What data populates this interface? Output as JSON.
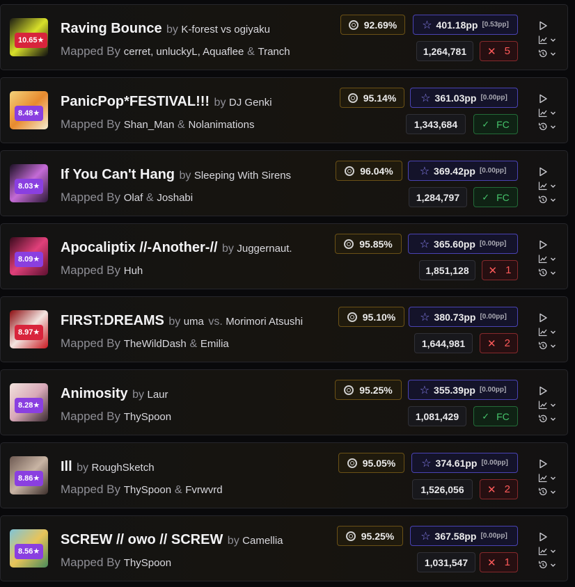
{
  "scores": [
    {
      "title": "Raving Bounce",
      "by": "by",
      "artist_parts": [
        "K-forest vs ogiyaku"
      ],
      "mapped_by": "Mapped By",
      "mappers": [
        "cerret, unluckyL, Aquaflee",
        "Tranch"
      ],
      "difficulty": "10.65★",
      "difficulty_color": "#d8243c",
      "accuracy": "92.69%",
      "pp": "401.18pp",
      "pp_gain": "[0.53pp]",
      "score": "1,264,781",
      "result": {
        "type": "miss",
        "value": "5"
      },
      "cover_colors": [
        "#1b1b12",
        "#d8e02a",
        "#0e0e0e"
      ]
    },
    {
      "title": "PanicPop*FESTIVAL!!!",
      "by": "by",
      "artist_parts": [
        "DJ Genki"
      ],
      "mapped_by": "Mapped By",
      "mappers": [
        "Shan_Man",
        "Nolanimations"
      ],
      "difficulty": "8.48★",
      "difficulty_color": "#8a3fe0",
      "accuracy": "95.14%",
      "pp": "361.03pp",
      "pp_gain": "[0.00pp]",
      "score": "1,343,684",
      "result": {
        "type": "fc",
        "value": "FC"
      },
      "cover_colors": [
        "#f3d27a",
        "#e88a2e",
        "#f6ecd0"
      ]
    },
    {
      "title": "If You Can't Hang",
      "by": "by",
      "artist_parts": [
        "Sleeping With Sirens"
      ],
      "mapped_by": "Mapped By",
      "mappers": [
        "Olaf",
        "Joshabi"
      ],
      "difficulty": "8.03★",
      "difficulty_color": "#8a3fe0",
      "accuracy": "96.04%",
      "pp": "369.42pp",
      "pp_gain": "[0.00pp]",
      "score": "1,284,797",
      "result": {
        "type": "fc",
        "value": "FC"
      },
      "cover_colors": [
        "#1a0f22",
        "#c46bd6",
        "#2c1836"
      ]
    },
    {
      "title": "Apocaliptix //-Another-//",
      "by": "by",
      "artist_parts": [
        "Juggernaut."
      ],
      "mapped_by": "Mapped By",
      "mappers": [
        "Huh"
      ],
      "difficulty": "8.09★",
      "difficulty_color": "#8a3fe0",
      "accuracy": "95.85%",
      "pp": "365.60pp",
      "pp_gain": "[0.00pp]",
      "score": "1,851,128",
      "result": {
        "type": "miss",
        "value": "1"
      },
      "cover_colors": [
        "#3a0a1c",
        "#e0407a",
        "#5e1030"
      ]
    },
    {
      "title": "FIRST:DREAMS",
      "by": "by",
      "artist_parts": [
        "uma",
        "vs.",
        "Morimori Atsushi"
      ],
      "mapped_by": "Mapped By",
      "mappers": [
        "TheWildDash",
        "Emilia"
      ],
      "difficulty": "8.97★",
      "difficulty_color": "#d8243c",
      "accuracy": "95.10%",
      "pp": "380.73pp",
      "pp_gain": "[0.00pp]",
      "score": "1,644,981",
      "result": {
        "type": "miss",
        "value": "2"
      },
      "cover_colors": [
        "#8c0c10",
        "#f2e4e0",
        "#c81820"
      ]
    },
    {
      "title": "Animosity",
      "by": "by",
      "artist_parts": [
        "Laur"
      ],
      "mapped_by": "Mapped By",
      "mappers": [
        "ThySpoon"
      ],
      "difficulty": "8.28★",
      "difficulty_color": "#8a3fe0",
      "accuracy": "95.25%",
      "pp": "355.39pp",
      "pp_gain": "[0.00pp]",
      "score": "1,081,429",
      "result": {
        "type": "fc",
        "value": "FC"
      },
      "cover_colors": [
        "#f2e2dc",
        "#d8a8b8",
        "#3a2a30"
      ]
    },
    {
      "title": "Ill",
      "by": "by",
      "artist_parts": [
        "RoughSketch"
      ],
      "mapped_by": "Mapped By",
      "mappers": [
        "ThySpoon",
        "Fvrwvrd"
      ],
      "difficulty": "8.86★",
      "difficulty_color": "#8a3fe0",
      "accuracy": "95.05%",
      "pp": "374.61pp",
      "pp_gain": "[0.00pp]",
      "score": "1,526,056",
      "result": {
        "type": "miss",
        "value": "2"
      },
      "cover_colors": [
        "#6e5a52",
        "#c8b4a4",
        "#3e302c"
      ]
    },
    {
      "title": "SCREW // owo // SCREW",
      "by": "by",
      "artist_parts": [
        "Camellia"
      ],
      "mapped_by": "Mapped By",
      "mappers": [
        "ThySpoon"
      ],
      "difficulty": "8.56★",
      "difficulty_color": "#8a3fe0",
      "accuracy": "95.25%",
      "pp": "367.58pp",
      "pp_gain": "[0.00pp]",
      "score": "1,031,547",
      "result": {
        "type": "miss",
        "value": "1"
      },
      "cover_colors": [
        "#7fc4d8",
        "#e8c45a",
        "#4a8a5a"
      ]
    }
  ],
  "separators": {
    "and": "&"
  },
  "icons": {
    "accuracy": "target-icon",
    "pp": "star-icon",
    "miss": "x-icon",
    "fc": "check-icon",
    "play": "play-icon",
    "graph": "chart-icon",
    "history": "history-icon",
    "expand": "chevron-down-icon"
  },
  "colors": {
    "pp_accent": "#8b84f5",
    "miss": "#ff5a5a",
    "fc": "#46c46b",
    "accuracy_border": "#6b5116"
  }
}
